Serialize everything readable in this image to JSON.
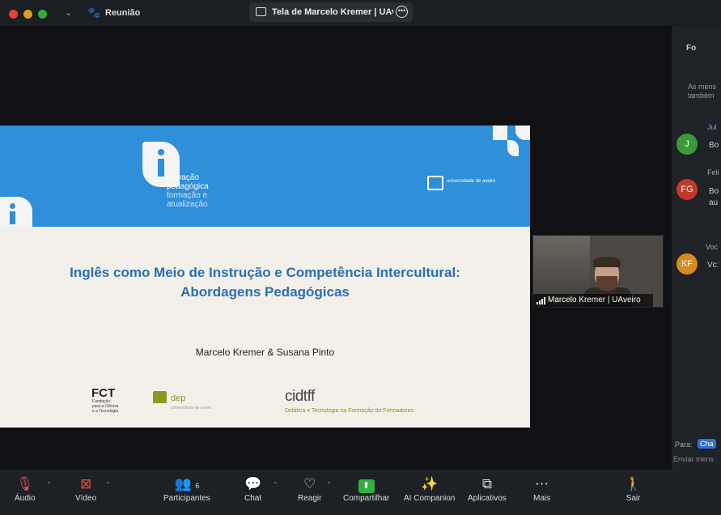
{
  "window": {
    "meeting_label": "Reunião",
    "share_title": "Tela de Marcelo Kremer | UAveiro"
  },
  "slide": {
    "brand_line1": "inovação",
    "brand_line2": "pedagógica",
    "brand_line3": "formação e",
    "brand_line4": "atualização",
    "university": "universidade de aveiro",
    "title_line1": "Inglês como Meio de Instrução e Competência Intercultural:",
    "title_line2": "Abordagens Pedagógicas",
    "authors": "Marcelo Kremer & Susana Pinto",
    "logo_fct": "FCT",
    "logo_fct_sub1": "Fundação",
    "logo_fct_sub2": "para a Ciência",
    "logo_fct_sub3": "e a Tecnologia",
    "logo_dep": "dep",
    "logo_dep_sub": "universidade de aveiro",
    "logo_cidtff": "cidtff",
    "logo_cidtff_sub": "Didática e Tecnologia na Formação de Formadores"
  },
  "participant": {
    "name": "Marcelo Kremer | UAveiro"
  },
  "chat": {
    "header": "Fo",
    "notice": "As mens",
    "notice2": "também",
    "messages": [
      {
        "initial": "J",
        "color": "#3a9a3a",
        "name": "Jul",
        "text": "Bo"
      },
      {
        "initial": "FG",
        "color": "#c0392b",
        "name": "Feli",
        "text": "Bo",
        "text2": "au"
      },
      {
        "initial": "KF",
        "color": "#d98a1f",
        "name": "Voc",
        "text": "Vc:"
      }
    ],
    "to_label": "Para:",
    "to_value": "Cha",
    "input_placeholder": "Enviar mens"
  },
  "toolbar": {
    "audio": "Áudio",
    "video": "Vídeo",
    "participants": "Participantes",
    "participants_count": "6",
    "chat": "Chat",
    "react": "Reagir",
    "share": "Compartilhar",
    "ai": "AI Companion",
    "apps": "Aplicativos",
    "more": "Mais",
    "leave": "Sair"
  }
}
